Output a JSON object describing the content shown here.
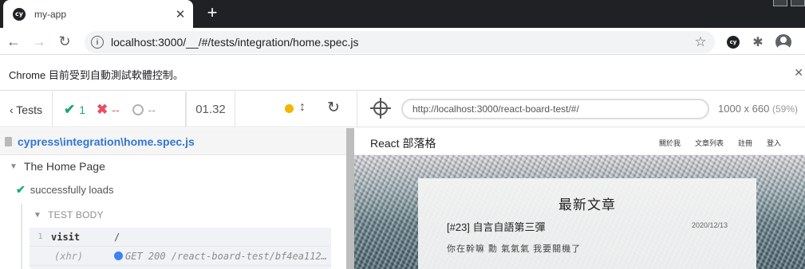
{
  "browser": {
    "tab_title": "my-app",
    "favicon_text": "cy",
    "tab_close": "✕",
    "new_tab": "+",
    "url": "localhost:3000/__/#/tests/integration/home.spec.js",
    "info_icon": "i",
    "star_icon": "☆",
    "ext_cy_text": "cy",
    "puzzle_icon": "✱",
    "infobar_text": "Chrome 目前受到自動測試軟體控制。",
    "infobar_close": "✕"
  },
  "runner": {
    "tests_label": "‹ Tests",
    "passed_icon": "✔",
    "passed": "1",
    "failed_icon": "✖",
    "failed": "--",
    "pending": "--",
    "duration": "01.32",
    "updown_icon": "↕",
    "rerun_icon": "↻",
    "aut_url": "http://localhost:3000/react-board-test/#/",
    "viewport": "1000 x 660",
    "viewport_pct": "(59%)"
  },
  "reporter": {
    "spec_file": "cypress\\integration\\home.spec.js",
    "suite_title": "The Home Page",
    "suite_caret": "▼",
    "test_check": "✔",
    "test_title": "successfully loads",
    "body_caret": "▼",
    "body_label": "TEST BODY",
    "commands": [
      {
        "num": "1",
        "name": "visit",
        "message": "/"
      },
      {
        "num": "",
        "name": "(xhr)",
        "message": "GET 200 /react-board-test/bf4ea112f7..."
      }
    ]
  },
  "app": {
    "brand": "React 部落格",
    "nav_links": [
      "關於我",
      "文章列表",
      "註冊",
      "登入"
    ],
    "section_title": "最新文章",
    "post_title": "[#23] 自言自語第三彈",
    "post_date": "2020/12/13",
    "post_excerpt": "你在幹嘛 勳 氣氣氣 我要關機了"
  },
  "colors": {
    "pass": "#1fa971",
    "fail": "#e94f5f",
    "link": "#3276d5",
    "running": "#f4b400",
    "xhr": "#3b82f6"
  }
}
